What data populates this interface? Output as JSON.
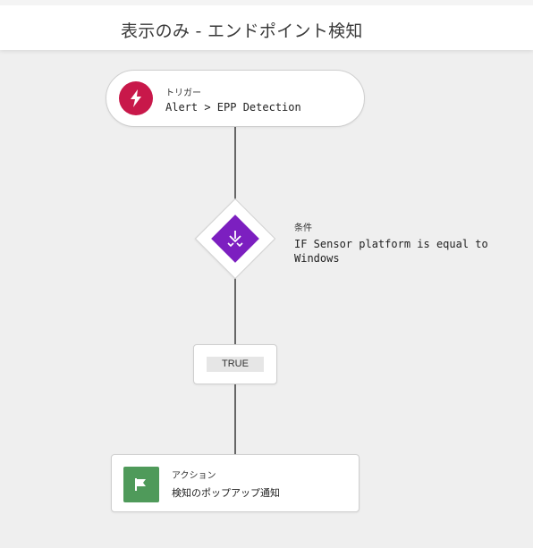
{
  "header": {
    "title": "表示のみ - エンドポイント検知"
  },
  "trigger": {
    "kind": "トリガー",
    "value": "Alert > EPP Detection",
    "icon": "lightning-icon",
    "color": "#c8184a"
  },
  "condition": {
    "kind": "条件",
    "value": "IF Sensor platform is equal to Windows",
    "icon": "branch-merge-icon",
    "color": "#7c1fc0"
  },
  "branch": {
    "label": "TRUE"
  },
  "action": {
    "kind": "アクション",
    "value": "検知のポップアップ通知",
    "icon": "flag-icon",
    "color": "#4f9a5a"
  }
}
